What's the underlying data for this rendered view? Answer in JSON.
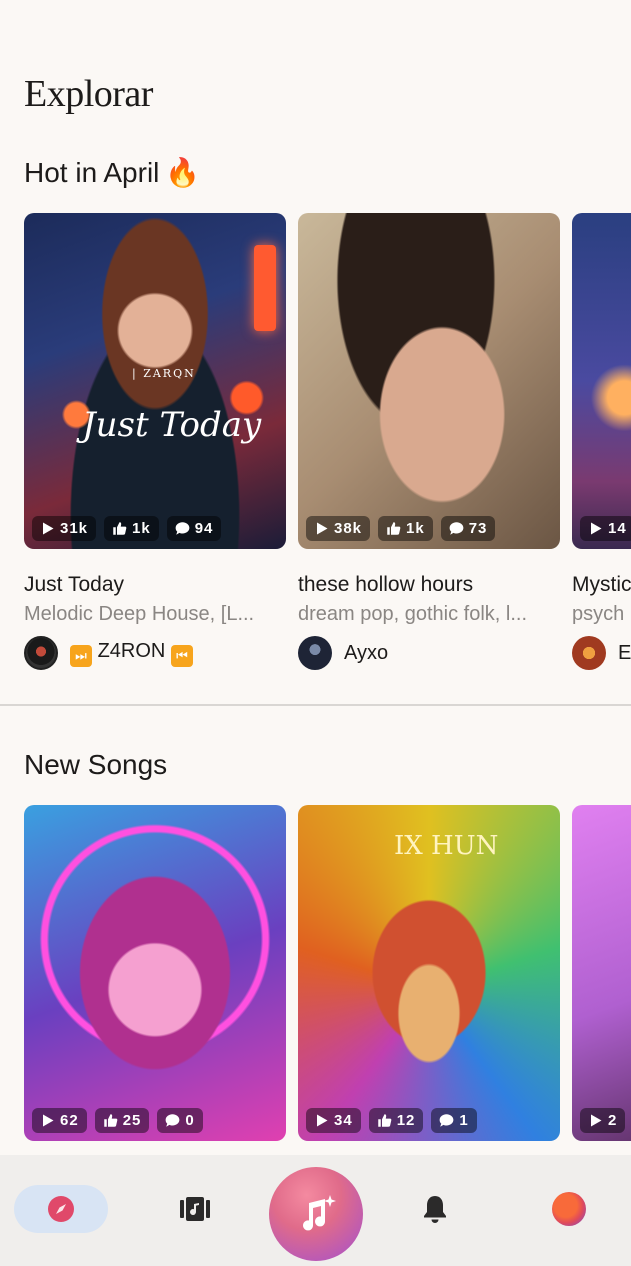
{
  "page": {
    "title": "Explorar"
  },
  "sections": [
    {
      "title": "Hot in April",
      "emoji": "🔥",
      "cards": [
        {
          "title": "Just Today",
          "genre": "Melodic Deep House, [L...",
          "author": "Z4RON",
          "author_prefix": "⏭",
          "author_suffix": "⏮",
          "plays": "31k",
          "likes": "1k",
          "comments": "94",
          "art_text_small": "| ZARQN",
          "art_text_big": "Just Today"
        },
        {
          "title": "these hollow hours",
          "genre": "dream pop, gothic folk, l...",
          "author": "Ayxo",
          "plays": "38k",
          "likes": "1k",
          "comments": "73"
        },
        {
          "title": "Mystic",
          "genre": "psych",
          "author": "E",
          "plays": "14"
        }
      ]
    },
    {
      "title": "New Songs",
      "cards": [
        {
          "plays": "62",
          "likes": "25",
          "comments": "0"
        },
        {
          "plays": "34",
          "likes": "12",
          "comments": "1",
          "art_text_big": "IX HUN"
        },
        {
          "plays": "2"
        }
      ]
    }
  ],
  "nav": {
    "items": [
      "explore-icon",
      "library-icon",
      "create-icon",
      "bell-icon",
      "profile-avatar"
    ],
    "accent": "#e0496a"
  }
}
